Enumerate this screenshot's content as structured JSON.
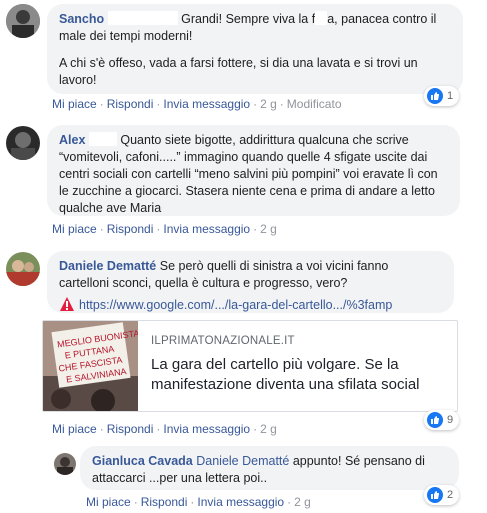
{
  "comments": [
    {
      "author": "Sancho",
      "text_line1": "Grandi! Sempre viva la f",
      "text_line1b": "a, panacea contro il",
      "text_line2": "male dei tempi moderni!",
      "text_line3": "A chi s'è offeso, vada a farsi fottere, si dia una lavata e si trovi un",
      "text_line4": "lavoro!",
      "actions": {
        "like": "Mi piace",
        "reply": "Rispondi",
        "message": "Invia messaggio",
        "time": "2 g",
        "edited": "Modificato"
      },
      "reactions": "1"
    },
    {
      "author": "Alex",
      "text_line1": "Quanto siete bigotte, addirittura qualcuna che scrive",
      "text_line2": "“vomitevoli, cafoni.....” immagino quando quelle 4 sfigate uscite dai",
      "text_line3": "centri sociali con cartelli “meno salvini più pompini” voi eravate lì con",
      "text_line4": "le zucchine a giocarci. Stasera niente cena e prima di andare a letto",
      "text_line5": "qualche ave Maria",
      "actions": {
        "like": "Mi piace",
        "reply": "Rispondi",
        "message": "Invia messaggio",
        "time": "2 g"
      }
    },
    {
      "author": "Daniele Dematté",
      "text_line1": "Se però quelli di sinistra a voi vicini fanno",
      "text_line2": "cartelloni sconci, quella è cultura e progresso, vero?",
      "link": "https://www.google.com/.../la-gara-del-cartello.../%3famp",
      "card": {
        "domain": "ILPRIMATONAZIONALE.IT",
        "title": "La gara del cartello più volgare. Se la manifestazione diventa una sfilata social",
        "image_sign": "MEGLIO BUONISTA E PUTTANA CHE FASCISTA E SALVINIANA"
      },
      "actions": {
        "like": "Mi piace",
        "reply": "Rispondi",
        "message": "Invia messaggio",
        "time": "2 g"
      },
      "reactions": "9"
    },
    {
      "author": "Gianluca Cavada",
      "mention": "Daniele Dematté",
      "text_line1": "appunto! Sé pensano di",
      "text_line2": "attaccarci ...per una lettera poi..",
      "actions": {
        "like": "Mi piace",
        "reply": "Rispondi",
        "message": "Invia messaggio",
        "time": "2 g"
      },
      "reactions": "2"
    }
  ],
  "colors": {
    "link": "#385898",
    "bubble": "#f2f3f5",
    "like": "#1877f2",
    "meta": "#90949c"
  },
  "icons": {
    "like": "thumbs-up-icon",
    "warning": "warning-icon"
  }
}
